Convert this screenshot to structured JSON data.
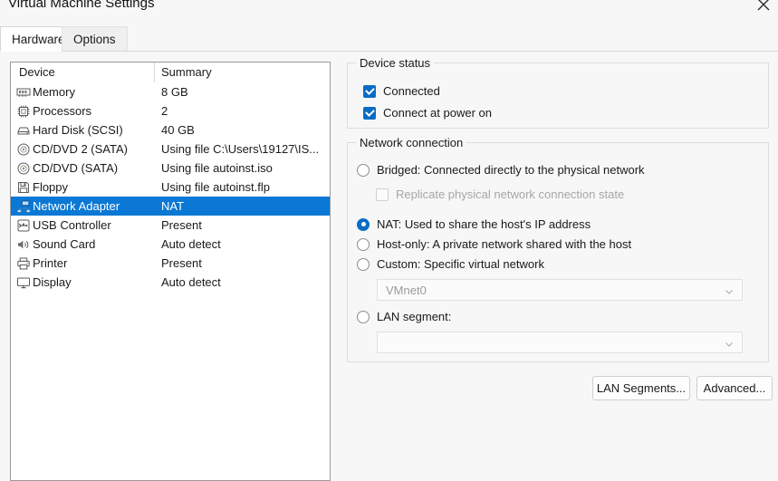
{
  "window": {
    "title": "Virtual Machine Settings",
    "close_icon": "close-icon"
  },
  "tabs": [
    {
      "label": "Hardware",
      "active": true
    },
    {
      "label": "Options",
      "active": false
    }
  ],
  "device_list": {
    "columns": {
      "device": "Device",
      "summary": "Summary"
    },
    "rows": [
      {
        "icon": "memory-icon",
        "name": "Memory",
        "summary": "8 GB",
        "selected": false
      },
      {
        "icon": "processor-icon",
        "name": "Processors",
        "summary": "2",
        "selected": false
      },
      {
        "icon": "hard-disk-icon",
        "name": "Hard Disk (SCSI)",
        "summary": "40 GB",
        "selected": false
      },
      {
        "icon": "cd-dvd-icon",
        "name": "CD/DVD 2 (SATA)",
        "summary": "Using file C:\\Users\\19127\\IS...",
        "selected": false
      },
      {
        "icon": "cd-dvd-icon",
        "name": "CD/DVD (SATA)",
        "summary": "Using file autoinst.iso",
        "selected": false
      },
      {
        "icon": "floppy-icon",
        "name": "Floppy",
        "summary": "Using file autoinst.flp",
        "selected": false
      },
      {
        "icon": "network-adapter-icon",
        "name": "Network Adapter",
        "summary": "NAT",
        "selected": true
      },
      {
        "icon": "usb-controller-icon",
        "name": "USB Controller",
        "summary": "Present",
        "selected": false
      },
      {
        "icon": "sound-card-icon",
        "name": "Sound Card",
        "summary": "Auto detect",
        "selected": false
      },
      {
        "icon": "printer-icon",
        "name": "Printer",
        "summary": "Present",
        "selected": false
      },
      {
        "icon": "display-icon",
        "name": "Display",
        "summary": "Auto detect",
        "selected": false
      }
    ]
  },
  "device_status": {
    "title": "Device status",
    "connected": {
      "label": "Connected",
      "checked": true
    },
    "connect_at_power_on": {
      "label": "Connect at power on",
      "checked": true
    }
  },
  "network_connection": {
    "title": "Network connection",
    "bridged": {
      "label": "Bridged: Connected directly to the physical network",
      "selected": false
    },
    "replicate": {
      "label": "Replicate physical network connection state",
      "checked": false,
      "disabled": true
    },
    "nat": {
      "label": "NAT: Used to share the host's IP address",
      "selected": true
    },
    "host_only": {
      "label": "Host-only: A private network shared with the host",
      "selected": false
    },
    "custom": {
      "label": "Custom: Specific virtual network",
      "selected": false
    },
    "custom_network_select": {
      "value": "VMnet0",
      "disabled": true
    },
    "lan_segment": {
      "label": "LAN segment:",
      "selected": false
    },
    "lan_segment_select": {
      "value": "",
      "disabled": true
    }
  },
  "buttons": {
    "lan_segments": "LAN Segments...",
    "advanced": "Advanced..."
  },
  "colors": {
    "accent": "#0a6cc4",
    "selection": "#0a78d4",
    "window_bg": "#f7f7f7",
    "list_bg": "#ffffff",
    "disabled_text": "#a6a6a6"
  }
}
